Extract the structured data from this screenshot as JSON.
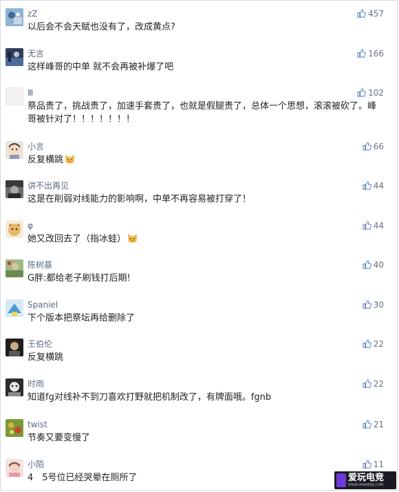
{
  "comments": [
    {
      "user": "zZ",
      "text": "以后会不会天赋也没有了，改成黄点?",
      "likes": "457",
      "avatar": "avatar-icon",
      "emoji": false
    },
    {
      "user": "无言",
      "text": "这样峰哥的中单 就不会再被补爆了吧",
      "likes": "166",
      "avatar": "avatar-icon",
      "emoji": false
    },
    {
      "user": "Ⅲ",
      "text": "祭品贵了，挑战贵了，加速手套贵了，也就是假腿贵了，总体一个思想，滚滚被砍了。峰哥被针对了！！！！！！！",
      "likes": "102",
      "avatar": "avatar-icon",
      "emoji": false
    },
    {
      "user": "小言",
      "text": "反复横跳",
      "likes": "66",
      "avatar": "avatar-icon",
      "emoji": true
    },
    {
      "user": "讲不出再见",
      "text": "这是在削弱对线能力的影响啊，中单不再容易被打穿了！",
      "likes": "44",
      "avatar": "avatar-icon",
      "emoji": false
    },
    {
      "user": "φ",
      "text": "她又改回去了（指冰蛙）",
      "likes": "44",
      "avatar": "avatar-icon",
      "emoji": true
    },
    {
      "user": "陈树基",
      "text": "G胖:都给老子刷钱打后期!",
      "likes": "40",
      "avatar": "avatar-icon",
      "emoji": false
    },
    {
      "user": "Spaniel",
      "text": "下个版本把祭坛再给删除了",
      "likes": "30",
      "avatar": "avatar-icon",
      "emoji": false
    },
    {
      "user": "王伯伦",
      "text": "反复横跳",
      "likes": "22",
      "avatar": "avatar-icon",
      "emoji": false
    },
    {
      "user": "时雨",
      "text": "知道fg对线补不到刀喜欢打野就把机制改了，有牌面哦。fgnb",
      "likes": "22",
      "avatar": "avatar-icon",
      "emoji": false
    },
    {
      "user": "twist",
      "text": "节奏又要变慢了",
      "likes": "21",
      "avatar": "avatar-icon",
      "emoji": false
    },
    {
      "user": "小陌",
      "text": "4　5号位已经哭晕在厕所了",
      "likes": "11",
      "avatar": "avatar-icon",
      "emoji": false
    }
  ],
  "watermark": {
    "title": "爱玩电竞",
    "subtitle": "WWW.AIWANDJ.COM"
  },
  "colors": {
    "name": "#5b6b80",
    "text": "#222222",
    "like": "#66707c"
  }
}
